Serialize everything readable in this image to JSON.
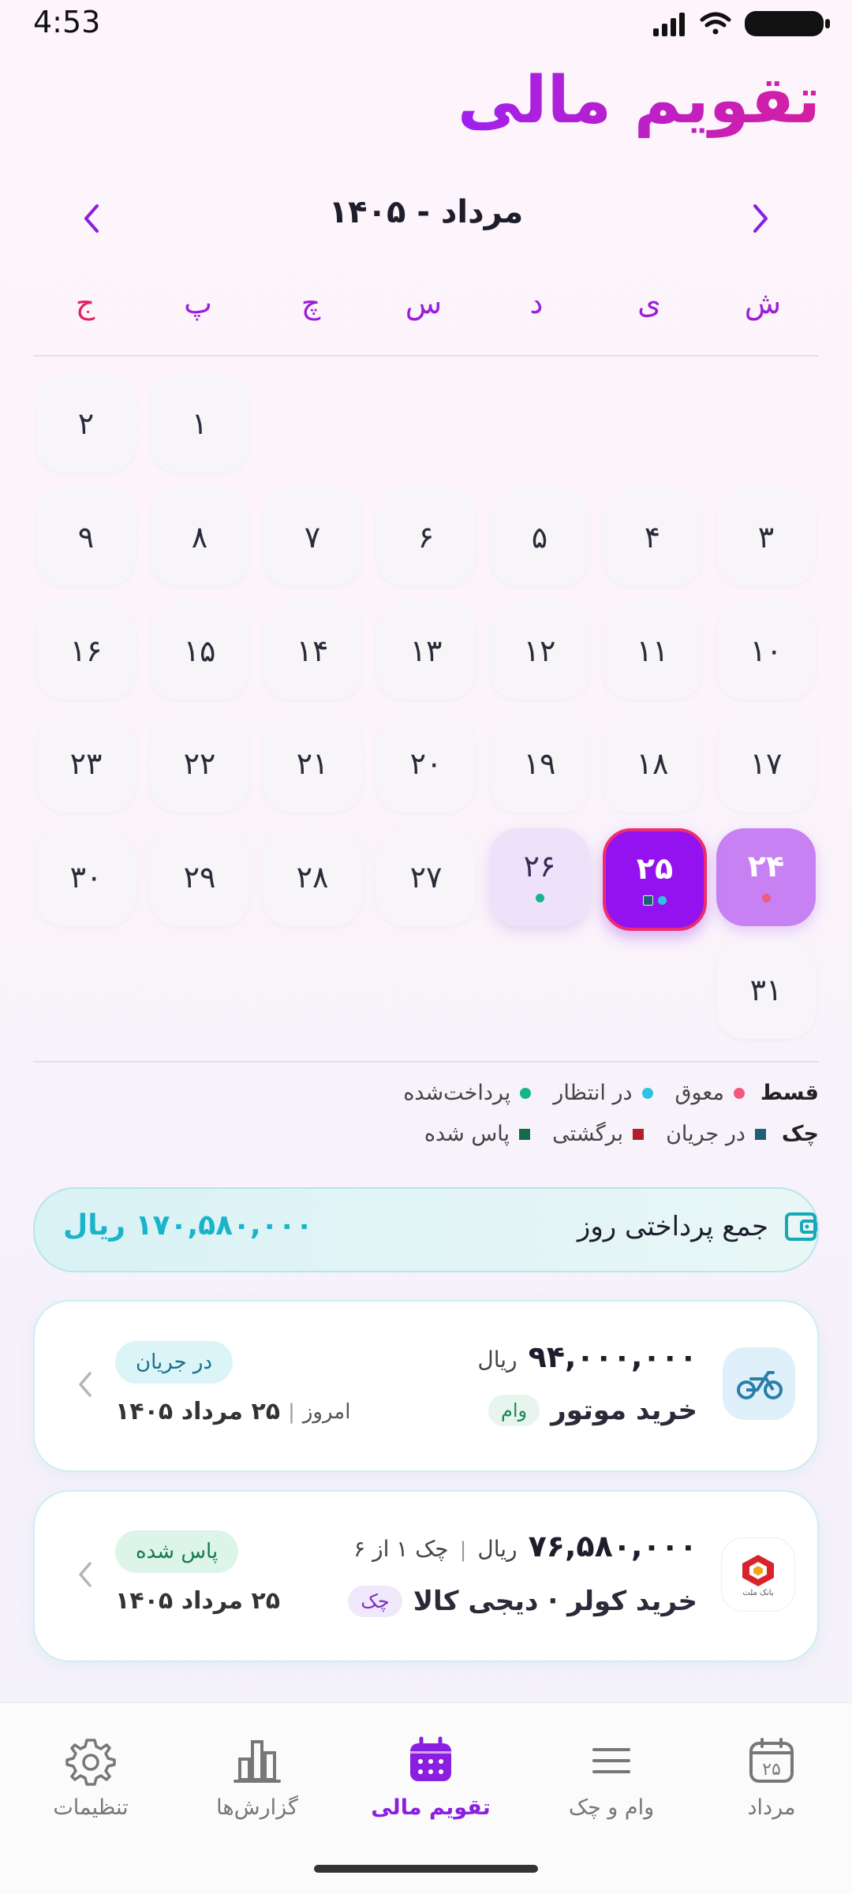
{
  "status_bar": {
    "time": "4:53"
  },
  "header": {
    "title": "تقویم مالی"
  },
  "calendar": {
    "month_label": "مرداد - ۱۴۰۵",
    "weekdays": [
      "ش",
      "ی",
      "د",
      "س",
      "چ",
      "پ",
      "ج"
    ],
    "days": [
      "۱",
      "۲",
      "۳",
      "۴",
      "۵",
      "۶",
      "۷",
      "۸",
      "۹",
      "۱۰",
      "۱۱",
      "۱۲",
      "۱۳",
      "۱۴",
      "۱۵",
      "۱۶",
      "۱۷",
      "۱۸",
      "۱۹",
      "۲۰",
      "۲۱",
      "۲۲",
      "۲۳",
      "۲۴",
      "۲۵",
      "۲۶",
      "۲۷",
      "۲۸",
      "۲۹",
      "۳۰",
      "۳۱"
    ],
    "selected_day": "۲۵"
  },
  "legend": {
    "installment_label": "قسط",
    "installment_items": [
      {
        "label": "معوق",
        "color": "#ef5a7e"
      },
      {
        "label": "در انتظار",
        "color": "#2cc4e0"
      },
      {
        "label": "پرداخت‌شده",
        "color": "#16b48a"
      }
    ],
    "check_label": "چک",
    "check_items": [
      {
        "label": "در جریان",
        "color": "#1f5f78"
      },
      {
        "label": "برگشتی",
        "color": "#b21f2a"
      },
      {
        "label": "پاس شده",
        "color": "#136b4a"
      }
    ]
  },
  "summary": {
    "label": "جمع پرداختی روز",
    "amount": "۱۷۰,۵۸۰,۰۰۰ ریال"
  },
  "items": [
    {
      "amount": "۹۴,۰۰۰,۰۰۰",
      "unit": "ریال",
      "title": "خرید موتور",
      "tag": "وام",
      "status": "در جریان",
      "date_prefix": "امروز",
      "date": "۲۵ مرداد ۱۴۰۵",
      "icon": "motorcycle-icon"
    },
    {
      "amount": "۷۶,۵۸۰,۰۰۰",
      "unit": "ریال",
      "sub": "چک ۱ از ۶",
      "title": "خرید کولر · دیجی کالا",
      "tag": "چک",
      "status": "پاس شده",
      "date": "۲۵ مرداد ۱۴۰۵",
      "icon": "bank-mellat-logo",
      "logo_text": "بانک ملت"
    }
  ],
  "bottom_nav": {
    "calendar_label": "مرداد",
    "calendar_icon_text": "۲۵",
    "loans_label": "وام و چک",
    "finance_calendar_label": "تقویم مالی",
    "reports_label": "گزارش‌ها",
    "settings_label": "تنظیمات"
  },
  "colors": {
    "accent": "#9411f0",
    "pink": "#e0245e",
    "teal": "#19b4c8"
  }
}
